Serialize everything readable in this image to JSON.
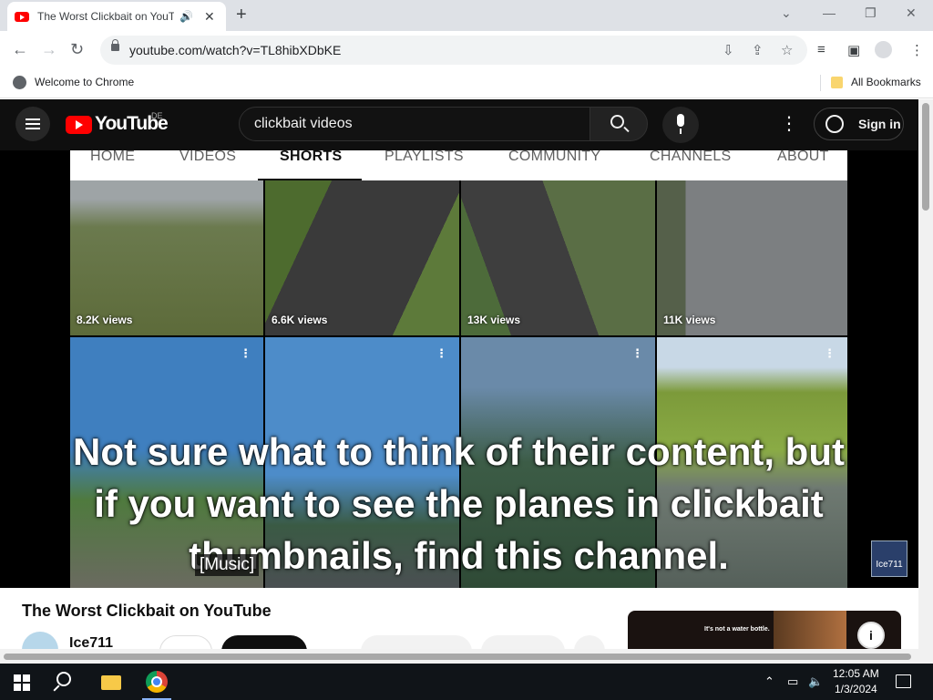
{
  "browser": {
    "tab_title": "The Worst Clickbait on YouTube - YouTube",
    "tab_audio_icon": "speaker-icon",
    "new_tab_label": "+",
    "url": "youtube.com/watch?v=TL8hibXDbKE",
    "bookmarks": {
      "welcome": "Welcome to Chrome",
      "all": "All Bookmarks"
    },
    "icons": [
      "back-icon",
      "forward-icon",
      "reload-icon",
      "lock-icon",
      "install-icon",
      "share-icon",
      "star-icon",
      "media-icon",
      "sidepanel-icon",
      "profile-icon",
      "menu-icon"
    ]
  },
  "youtube": {
    "logo": "YouTube",
    "region": "DE",
    "search_value": "clickbait videos",
    "sign_in": "Sign in",
    "channel_tabs": [
      "HOME",
      "VIDEOS",
      "SHORTS",
      "PLAYLISTS",
      "COMMUNITY",
      "CHANNELS",
      "ABOUT"
    ],
    "active_tab": "SHORTS",
    "shorts_views": [
      "8.2K views",
      "6.6K views",
      "13K views",
      "11K views"
    ],
    "caption": "Not sure what to think of their content, but if you want to see the planes in clickbait thumbnails, find this channel.",
    "cc_text": "[Music]",
    "watermark": "Ice711",
    "video_title": "The Worst Clickbait on YouTube",
    "channel_name": "Ice711",
    "ad_text": "It's not a water bottle.",
    "ad_info": "i"
  },
  "taskbar": {
    "time": "12:05 AM",
    "date": "1/3/2024"
  },
  "colors": {
    "yt_red": "#ff0000",
    "yt_dark": "#0f0f0f",
    "taskbar": "#101418"
  }
}
